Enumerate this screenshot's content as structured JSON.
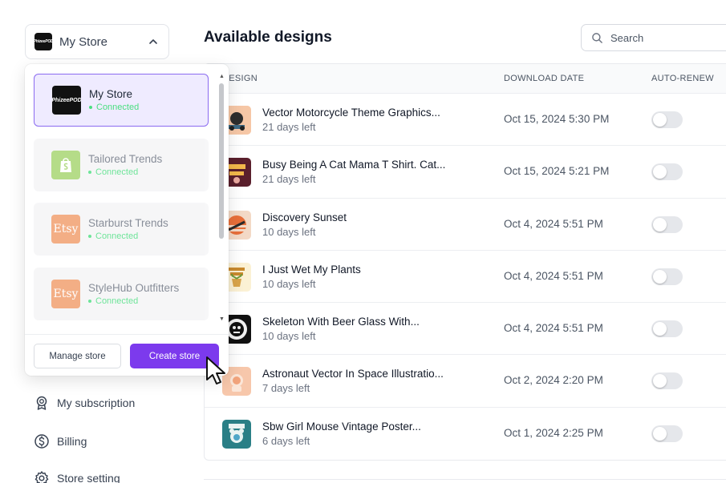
{
  "store_selector": {
    "name": "My Store",
    "logo_text": "PhizeePOD"
  },
  "nav": [
    {
      "label": "My subscription",
      "icon": "badge-icon"
    },
    {
      "label": "Billing",
      "icon": "dollar-icon"
    },
    {
      "label": "Store setting",
      "icon": "gear-icon"
    }
  ],
  "main": {
    "title": "Available designs",
    "search_placeholder": "Search",
    "columns": {
      "design": "DESIGN",
      "download_date": "DOWNLOAD DATE",
      "auto_renew": "AUTO-RENEW"
    },
    "rows": [
      {
        "title": "Vector Motorcycle Theme Graphics...",
        "days_left": "21 days left",
        "date": "Oct 15, 2024 5:30 PM",
        "auto_renew": false
      },
      {
        "title": "Busy Being A Cat Mama T Shirt. Cat...",
        "days_left": "21 days left",
        "date": "Oct 15, 2024 5:21 PM",
        "auto_renew": false
      },
      {
        "title": "Discovery Sunset",
        "days_left": "10 days left",
        "date": "Oct 4, 2024 5:51 PM",
        "auto_renew": false
      },
      {
        "title": "I Just Wet My Plants",
        "days_left": "10 days left",
        "date": "Oct 4, 2024 5:51 PM",
        "auto_renew": false
      },
      {
        "title": "Skeleton With Beer Glass With...",
        "days_left": "10 days left",
        "date": "Oct 4, 2024 5:51 PM",
        "auto_renew": false
      },
      {
        "title": "Astronaut Vector In Space Illustratio...",
        "days_left": "7 days left",
        "date": "Oct 2, 2024 2:20 PM",
        "auto_renew": false
      },
      {
        "title": "Sbw Girl Mouse Vintage Poster...",
        "days_left": "6 days left",
        "date": "Oct 1, 2024 2:25 PM",
        "auto_renew": false
      }
    ]
  },
  "dropdown": {
    "stores": [
      {
        "name": "My Store",
        "status": "Connected",
        "platform": "phizeepod",
        "logo_text": "PhizeePOD",
        "active": true
      },
      {
        "name": "Tailored Trends",
        "status": "Connected",
        "platform": "shopify",
        "logo_text": "",
        "active": false
      },
      {
        "name": "Starburst Trends",
        "status": "Connected",
        "platform": "etsy",
        "logo_text": "Etsy",
        "active": false
      },
      {
        "name": "StyleHub Outfitters",
        "status": "Connected",
        "platform": "etsy",
        "logo_text": "Etsy",
        "active": false
      }
    ],
    "manage_label": "Manage store",
    "create_label": "Create store"
  },
  "colors": {
    "accent": "#7c3aed",
    "connected": "#4ade80",
    "active_border": "#8b6bf0"
  }
}
